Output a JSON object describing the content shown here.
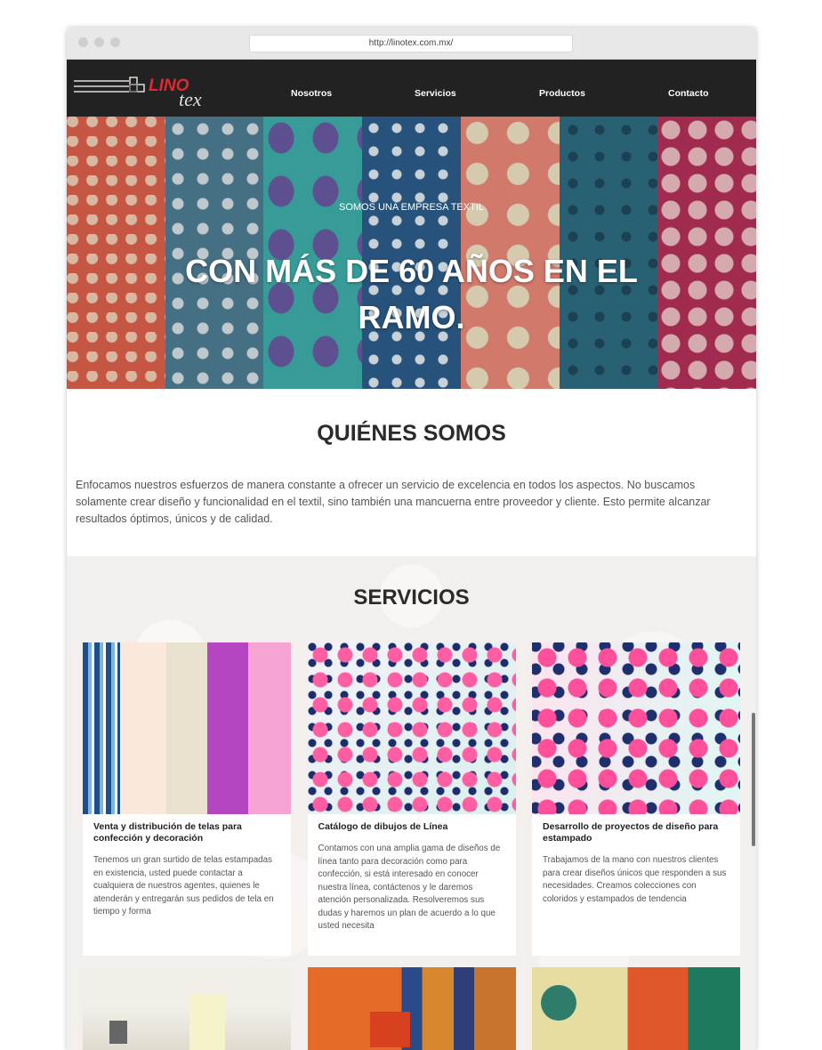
{
  "browser": {
    "url": "http://linotex.com.mx/"
  },
  "brand": {
    "logo_text_1": "LINO",
    "logo_text_2": "tex"
  },
  "nav": {
    "items": [
      "Nosotros",
      "Servicios",
      "Productos",
      "Contacto"
    ]
  },
  "hero": {
    "kicker": "SOMOS UNA EMPRESA TEXTIL",
    "headline": "CON MÁS DE 60 AÑOS EN EL RAMO."
  },
  "about": {
    "title": "QUIÉNES SOMOS",
    "text": "Enfocamos nuestros esfuerzos de manera constante a ofrecer un servicio de excelencia en todos los aspectos. No buscamos solamente crear diseño y funcionalidad en el textil, sino también una mancuerna entre proveedor y cliente. Esto permite alcanzar resultados óptimos, únicos y de calidad."
  },
  "services": {
    "title": "SERVICIOS",
    "cards": [
      {
        "title": "Venta y distribución de telas para confección y decoración",
        "text": "Tenemos un gran surtido de telas estampadas en existencia, usted puede contactar a cualquiera de nuestros agentes, quienes le atenderán y entregarán sus pedidos de tela en tiempo y forma"
      },
      {
        "title": "Catálogo de dibujos de Línea",
        "text": "Contamos con una amplia gama de diseños de línea tanto para decoración como para confección, si está interesado en conocer nuestra línea, contáctenos y le daremos atención personalizada. Resolveremos sus dudas y haremos un plan de acuerdo a lo que usted necesita"
      },
      {
        "title": "Desarrollo de proyectos de diseño para estampado",
        "text": "Trabajamos de la mano con nuestros clientes para crear diseños únicos que responden a sus necesidades. Creamos colecciones con coloridos y estampados de tendencia"
      }
    ]
  }
}
